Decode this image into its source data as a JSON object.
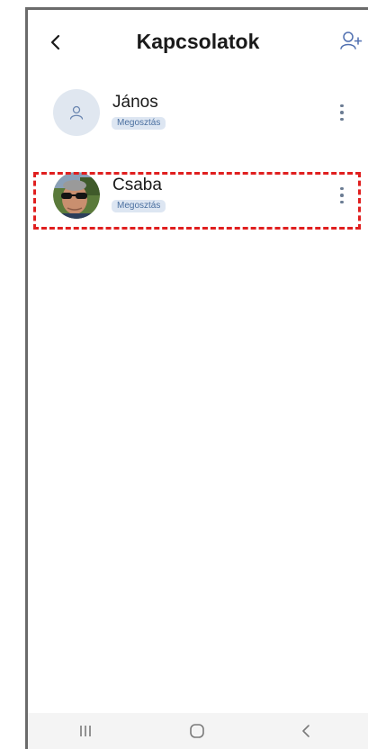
{
  "header": {
    "title": "Kapcsolatok",
    "back_icon": "chevron-left-icon",
    "add_icon": "add-person-icon"
  },
  "contacts": [
    {
      "name": "János",
      "badge": "Megosztás",
      "avatar": "person-placeholder-icon"
    },
    {
      "name": "Csaba",
      "badge": "Megosztás",
      "avatar": "photo"
    }
  ],
  "colors": {
    "highlight": "#e01f1f",
    "badge_bg": "#dde6f2",
    "badge_text": "#4a6fa0",
    "placeholder_bg": "#e0e7f0"
  },
  "navbar": {
    "recents_icon": "recents-icon",
    "home_icon": "home-icon",
    "back_icon": "back-icon"
  }
}
